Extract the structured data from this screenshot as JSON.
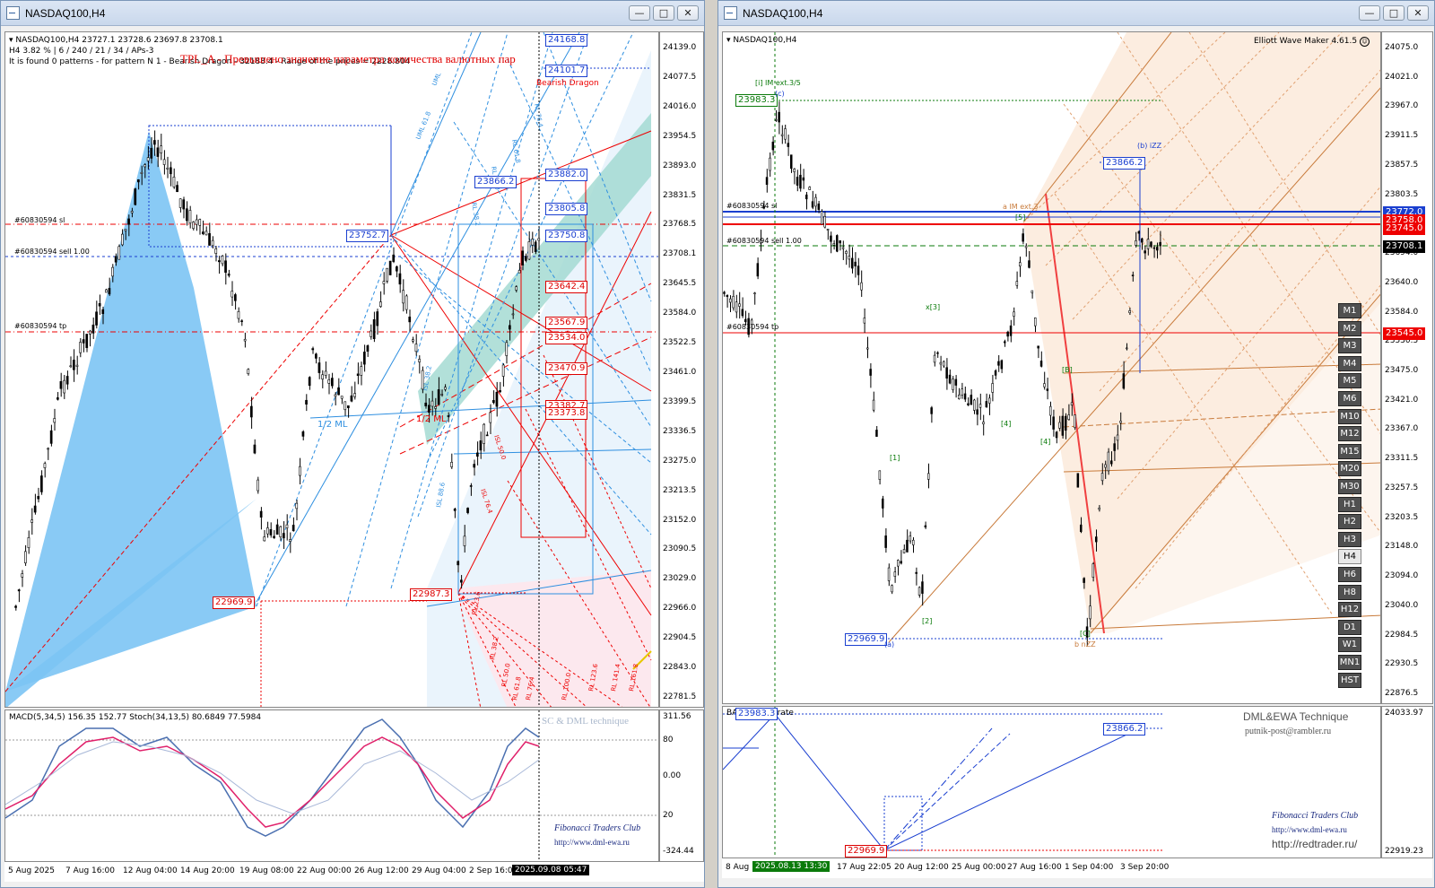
{
  "left_window": {
    "title": "NASDAQ100,H4",
    "header_line1": "NASDAQ100,H4  23727.1 23728.6 23697.8 23708.1",
    "header_line2": "H4  3.82 %  | 6 / 240 / 21 / 34 / APs-3",
    "header_line3": "It is found 0 patterns  -  for pattern N 1 - Bearish Dragon  -  32188.4 - Range of the prices = 2228.804",
    "red_title": "TPL_A - Превышено значение параметра количества валютных пар",
    "pattern_label": "Bearish Dragon",
    "order_lines": [
      "#60830594 sl",
      "#60830594 sell 1.00",
      "#60830594 tp"
    ],
    "price_axis": [
      "24139.0",
      "24077.5",
      "24016.0",
      "23954.5",
      "23893.0",
      "23831.5",
      "23768.5",
      "23708.1",
      "23645.5",
      "23584.0",
      "23522.5",
      "23461.0",
      "23399.5",
      "23336.5",
      "23275.0",
      "23213.5",
      "23152.0",
      "23090.5",
      "23029.0",
      "22966.0",
      "22904.5",
      "22843.0",
      "22781.5"
    ],
    "time_axis": [
      "5 Aug 2025",
      "7 Aug 16:00",
      "12 Aug 04:00",
      "14 Aug 20:00",
      "19 Aug 08:00",
      "22 Aug 00:00",
      "26 Aug 12:00",
      "29 Aug 04:00",
      "2 Sep 16:00",
      "2025.09.08 05:47"
    ],
    "blue_tags": [
      "24168.8",
      "24101.7",
      "23882.0",
      "23866.2",
      "23805.8",
      "23752.7",
      "23750.8"
    ],
    "red_tags": [
      "23642.4",
      "23567.9",
      "23534.0",
      "23470.9",
      "23382.7",
      "23373.8",
      "22969.9",
      "22987.3"
    ],
    "ml_labels": [
      "1/2 ML",
      "1/2 ML"
    ],
    "macd_header": "MACD(5,34,5) 156.35 152.77  Stoch(34,13,5) 80.6849 77.5984",
    "macd_axis": [
      "311.56",
      "80",
      "0.00",
      "20",
      "-324.44"
    ],
    "watermark": "SC & DML technique",
    "club": "Fibonacci Traders Club",
    "club_url": "http://www.dml-ewa.ru"
  },
  "right_window": {
    "title": "NASDAQ100,H4",
    "header": "NASDAQ100,H4",
    "ewm": "Elliott Wave Maker 4.61.5",
    "order_lines": [
      "#60830594 sl",
      "#60830594 sell 1.00",
      "#60830594 tp"
    ],
    "price_axis": [
      "24075.0",
      "24021.0",
      "23967.0",
      "23911.5",
      "23857.5",
      "23803.5",
      "23749.5",
      "23694.0",
      "23640.0",
      "23584.0",
      "23530.5",
      "23475.0",
      "23421.0",
      "23367.0",
      "23311.5",
      "23257.5",
      "23203.5",
      "23148.0",
      "23094.0",
      "23040.0",
      "22984.5",
      "22930.5",
      "22876.5"
    ],
    "axis_tags": {
      "blue_line": "23772.0",
      "red_1": "23758.0",
      "red_2": "23745.0",
      "current": "23708.1",
      "tp": "23545.0"
    },
    "wave_tags": {
      "top_green": "23983.3",
      "ib_blue": "23866.2",
      "low_blue": "22969.9"
    },
    "wave_labels": {
      "i_im": "[i] IM ext.3/5",
      "c_top": "(c)",
      "a_im": "a IM ext.3",
      "b_izz": "(b) iZZ",
      "x3": "x[3]",
      "a_low": "(a)",
      "b_nzz": "b nZZ",
      "w1": "[1]",
      "w2": "[2]",
      "w4": "[4]",
      "w4b": "[4]",
      "wB": "[B]",
      "wC": "[C]",
      "w5": "[5]"
    },
    "timeframes": [
      "M1",
      "M2",
      "M3",
      "M4",
      "M5",
      "M6",
      "M10",
      "M12",
      "M15",
      "M20",
      "M30",
      "H1",
      "H2",
      "H3",
      "H4",
      "H6",
      "H8",
      "H12",
      "D1",
      "W1",
      "MN1",
      "HST"
    ],
    "active_tf": "H4",
    "time_axis": [
      "8 Aug",
      "2025.08.13 13:30",
      "17 Aug 22:05",
      "20 Aug 12:00",
      "25 Aug 00:00",
      "27 Aug 16:00",
      "1 Sep 04:00",
      "3 Sep 20:00"
    ],
    "sub_header": "BA    ... 3 separate",
    "sub_tags": {
      "top": "23983.3",
      "mid": "23866.2",
      "low": "22969.9"
    },
    "sub_axis": [
      "24033.97",
      "22919.23"
    ],
    "brand": "DML&EWA Technique",
    "email": "putnik-post@rambler.ru",
    "club": "Fibonacci Traders Club",
    "club_url": "http://www.dml-ewa.ru",
    "redtrader": "http://redtrader.ru/"
  },
  "colors": {
    "blue": "#1a3fd0",
    "red": "#e00000",
    "green": "#0a7a0a",
    "orange": "#c87a3a",
    "fan_blue": "#2e8fe0"
  }
}
